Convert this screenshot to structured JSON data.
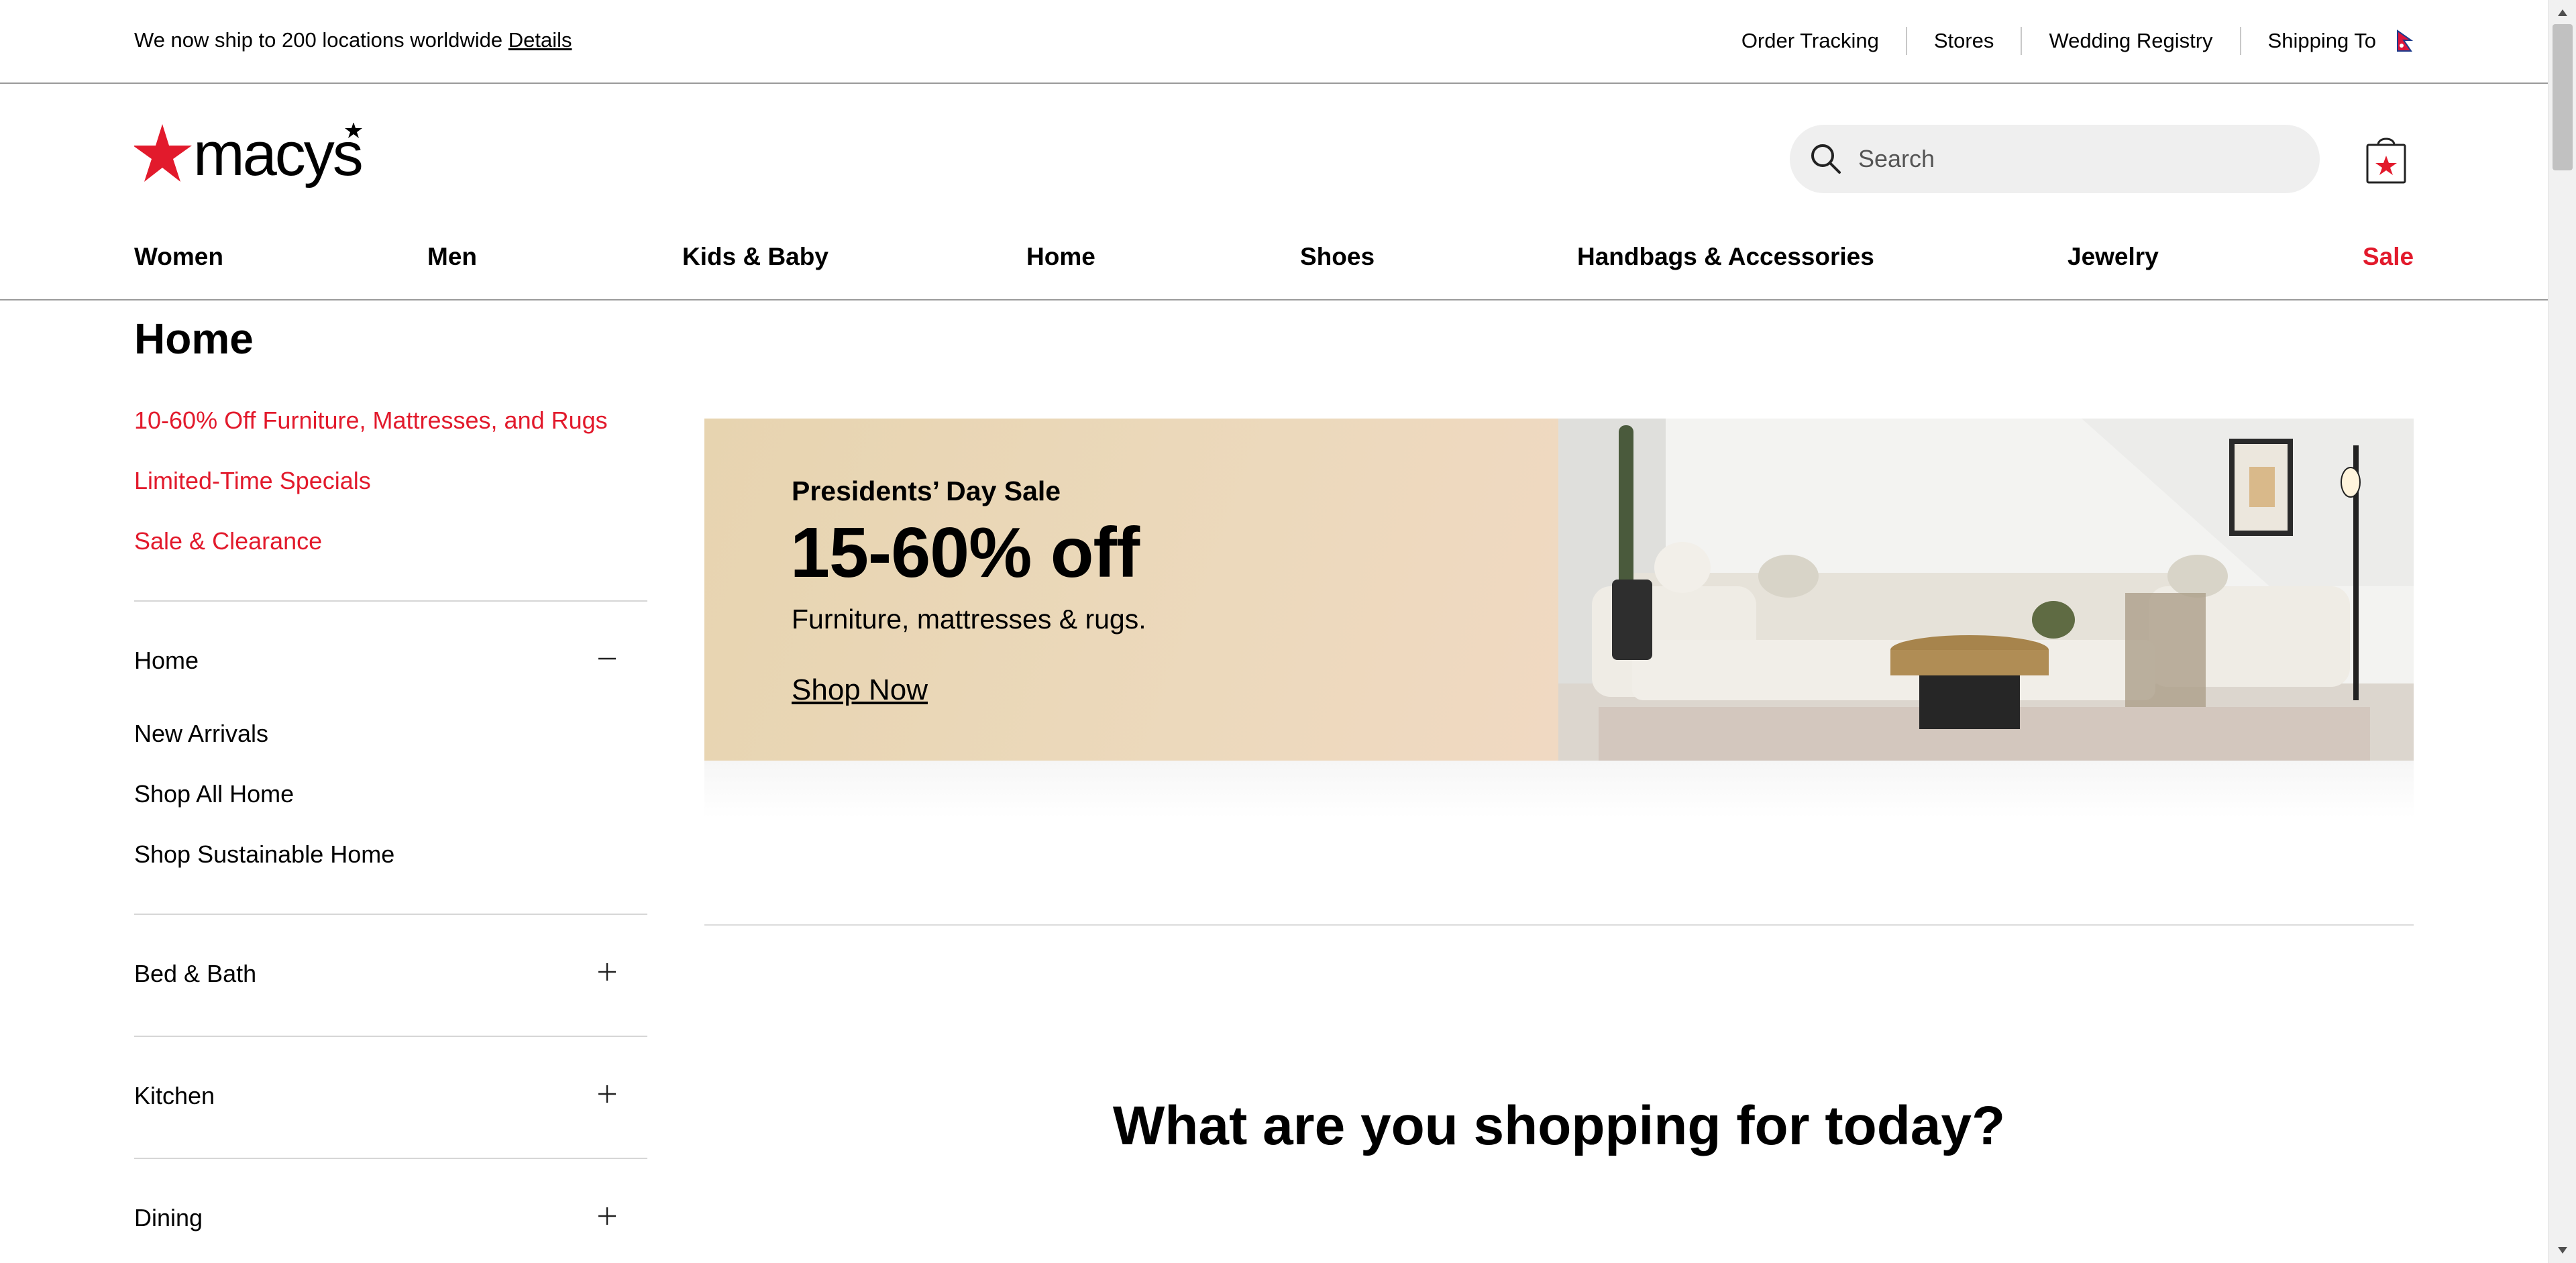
{
  "promo_bar": {
    "text": "We now ship to 200 locations worldwide",
    "link": "Details"
  },
  "utility_links": [
    "Order Tracking",
    "Stores",
    "Wedding Registry",
    "Shipping To"
  ],
  "search": {
    "placeholder": "Search"
  },
  "nav": [
    "Women",
    "Men",
    "Kids & Baby",
    "Home",
    "Shoes",
    "Handbags & Accessories",
    "Jewelry",
    "Sale"
  ],
  "page_title": "Home",
  "sidebar": {
    "promo_links": [
      "10-60% Off Furniture, Mattresses, and Rugs",
      "Limited-Time Specials",
      "Sale & Clearance"
    ],
    "sections": [
      {
        "label": "Home",
        "expanded": true,
        "items": [
          "New Arrivals",
          "Shop All Home",
          "Shop Sustainable Home"
        ]
      },
      {
        "label": "Bed & Bath",
        "expanded": false
      },
      {
        "label": "Kitchen",
        "expanded": false
      },
      {
        "label": "Dining",
        "expanded": false
      }
    ]
  },
  "hero": {
    "eyebrow": "Presidents’ Day Sale",
    "headline": "15-60% off",
    "subtext": "Furniture, mattresses & rugs.",
    "cta": "Shop Now"
  },
  "section_heading": "What are you shopping for today?",
  "colors": {
    "brand_red": "#e21a2c",
    "hero_bg": "#e8d6b6",
    "search_bg": "#efefef"
  },
  "icons": [
    "search-icon",
    "shopping-bag-icon",
    "flag-icon",
    "minus-icon",
    "plus-icon",
    "macys-star-logo"
  ]
}
